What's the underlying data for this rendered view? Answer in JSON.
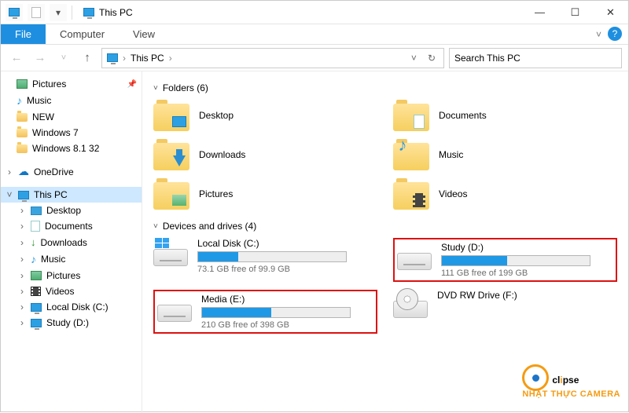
{
  "titlebar": {
    "title": "This PC"
  },
  "wincontrols": {
    "min": "—",
    "max": "☐",
    "close": "✕"
  },
  "ribbon": {
    "file": "File",
    "tabs": [
      "Computer",
      "View"
    ],
    "chevron": "˅",
    "help": "?"
  },
  "nav": {
    "back": "←",
    "fwd": "→",
    "recent": "˅",
    "up": "↑",
    "refresh": "↻",
    "dropdown": "˅"
  },
  "breadcrumb": {
    "root_icon": "monitor",
    "items": [
      "This PC"
    ],
    "sep": "›"
  },
  "search": {
    "placeholder": "Search This PC"
  },
  "tree": [
    {
      "icon": "pic",
      "label": "Pictures",
      "pinned": true
    },
    {
      "icon": "music",
      "label": "Music"
    },
    {
      "icon": "folder",
      "label": "NEW"
    },
    {
      "icon": "folder",
      "label": "Windows 7"
    },
    {
      "icon": "folder",
      "label": "Windows 8.1 32"
    },
    {
      "spacer": true
    },
    {
      "icon": "onedrive",
      "label": "OneDrive",
      "expandable": true
    },
    {
      "spacer": true
    },
    {
      "icon": "monitor",
      "label": "This PC",
      "selected": true,
      "expandable": true,
      "expanded": true
    },
    {
      "icon": "desktop",
      "label": "Desktop",
      "indent": 1,
      "expandable": true
    },
    {
      "icon": "doc",
      "label": "Documents",
      "indent": 1,
      "expandable": true
    },
    {
      "icon": "down",
      "label": "Downloads",
      "indent": 1,
      "expandable": true
    },
    {
      "icon": "music",
      "label": "Music",
      "indent": 1,
      "expandable": true
    },
    {
      "icon": "pic",
      "label": "Pictures",
      "indent": 1,
      "expandable": true
    },
    {
      "icon": "video",
      "label": "Videos",
      "indent": 1,
      "expandable": true
    },
    {
      "icon": "drive",
      "label": "Local Disk (C:)",
      "indent": 1,
      "expandable": true
    },
    {
      "icon": "drive",
      "label": "Study (D:)",
      "indent": 1,
      "expandable": true,
      "cut": true
    }
  ],
  "sections": {
    "folders": {
      "title": "Folders (6)",
      "caret": "˅"
    },
    "drives": {
      "title": "Devices and drives (4)",
      "caret": "˅"
    }
  },
  "folders": [
    {
      "name": "Desktop",
      "badge": "desktop"
    },
    {
      "name": "Documents",
      "badge": "doc"
    },
    {
      "name": "Downloads",
      "badge": "down"
    },
    {
      "name": "Music",
      "badge": "music"
    },
    {
      "name": "Pictures",
      "badge": "pic"
    },
    {
      "name": "Videos",
      "badge": "video"
    }
  ],
  "drives": [
    {
      "name": "Local Disk (C:)",
      "free": "73.1 GB free of 99.9 GB",
      "fill": 27,
      "os": true,
      "highlight": false
    },
    {
      "name": "Study (D:)",
      "free": "111 GB free of 199 GB",
      "fill": 44,
      "highlight": true
    },
    {
      "name": "Media (E:)",
      "free": "210 GB free of 398 GB",
      "fill": 47,
      "highlight": true
    },
    {
      "name": "DVD RW Drive (F:)",
      "dvd": true,
      "highlight": false
    }
  ],
  "watermark": {
    "brand_pre": "cl",
    "brand_i": "i",
    "brand_post": "pse",
    "subtitle": "NHẬT THỰC CAMERA"
  }
}
